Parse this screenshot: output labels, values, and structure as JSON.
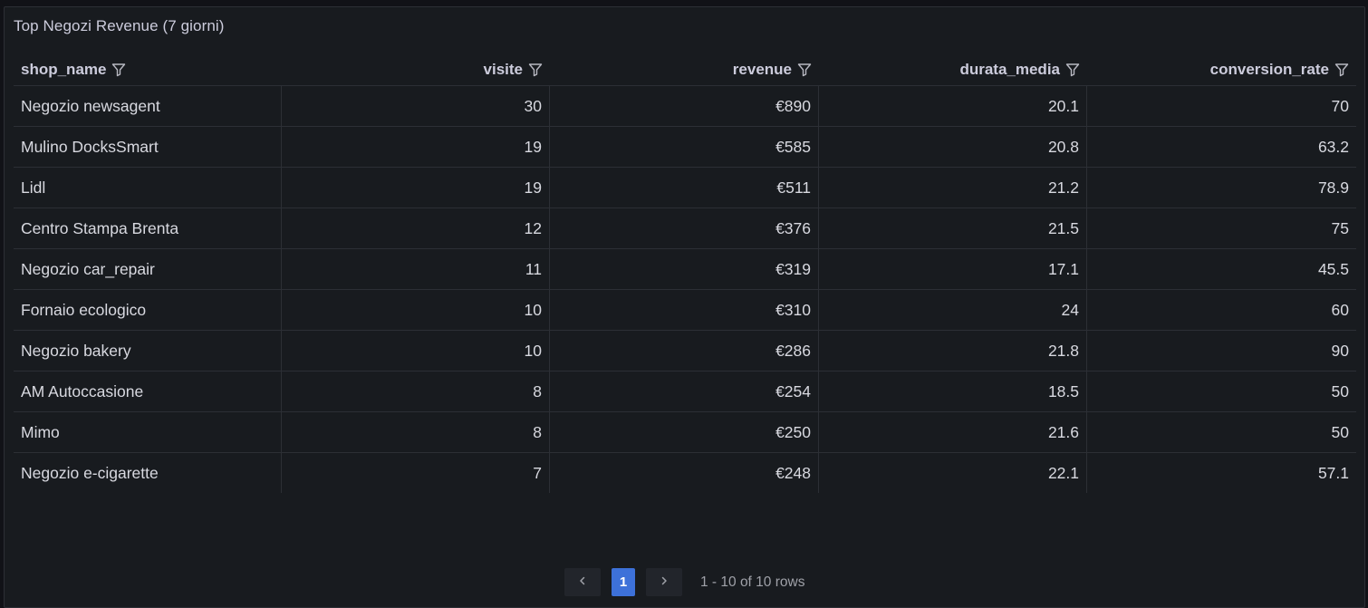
{
  "panel": {
    "title": "Top Negozi Revenue (7 giorni)"
  },
  "table": {
    "columns": [
      "shop_name",
      "visite",
      "revenue",
      "durata_media",
      "conversion_rate"
    ],
    "rows": [
      [
        "Negozio newsagent",
        "30",
        "€890",
        "20.1",
        "70"
      ],
      [
        "Mulino DocksSmart",
        "19",
        "€585",
        "20.8",
        "63.2"
      ],
      [
        "Lidl",
        "19",
        "€511",
        "21.2",
        "78.9"
      ],
      [
        "Centro Stampa Brenta",
        "12",
        "€376",
        "21.5",
        "75"
      ],
      [
        "Negozio car_repair",
        "11",
        "€319",
        "17.1",
        "45.5"
      ],
      [
        "Fornaio ecologico",
        "10",
        "€310",
        "24",
        "60"
      ],
      [
        "Negozio bakery",
        "10",
        "€286",
        "21.8",
        "90"
      ],
      [
        "AM Autoccasione",
        "8",
        "€254",
        "18.5",
        "50"
      ],
      [
        "Mimo",
        "8",
        "€250",
        "21.6",
        "50"
      ],
      [
        "Negozio e-cigarette",
        "7",
        "€248",
        "22.1",
        "57.1"
      ]
    ]
  },
  "pagination": {
    "current_page": "1",
    "rows_summary": "1 - 10 of 10 rows"
  },
  "icons": {
    "filter": "filter-icon",
    "prev": "chevron-left-icon",
    "next": "chevron-right-icon"
  },
  "colors": {
    "background": "#111217",
    "panel": "#181b1f",
    "border": "#2c2f35",
    "text": "#d8d9e0",
    "accent": "#3d71d9"
  }
}
